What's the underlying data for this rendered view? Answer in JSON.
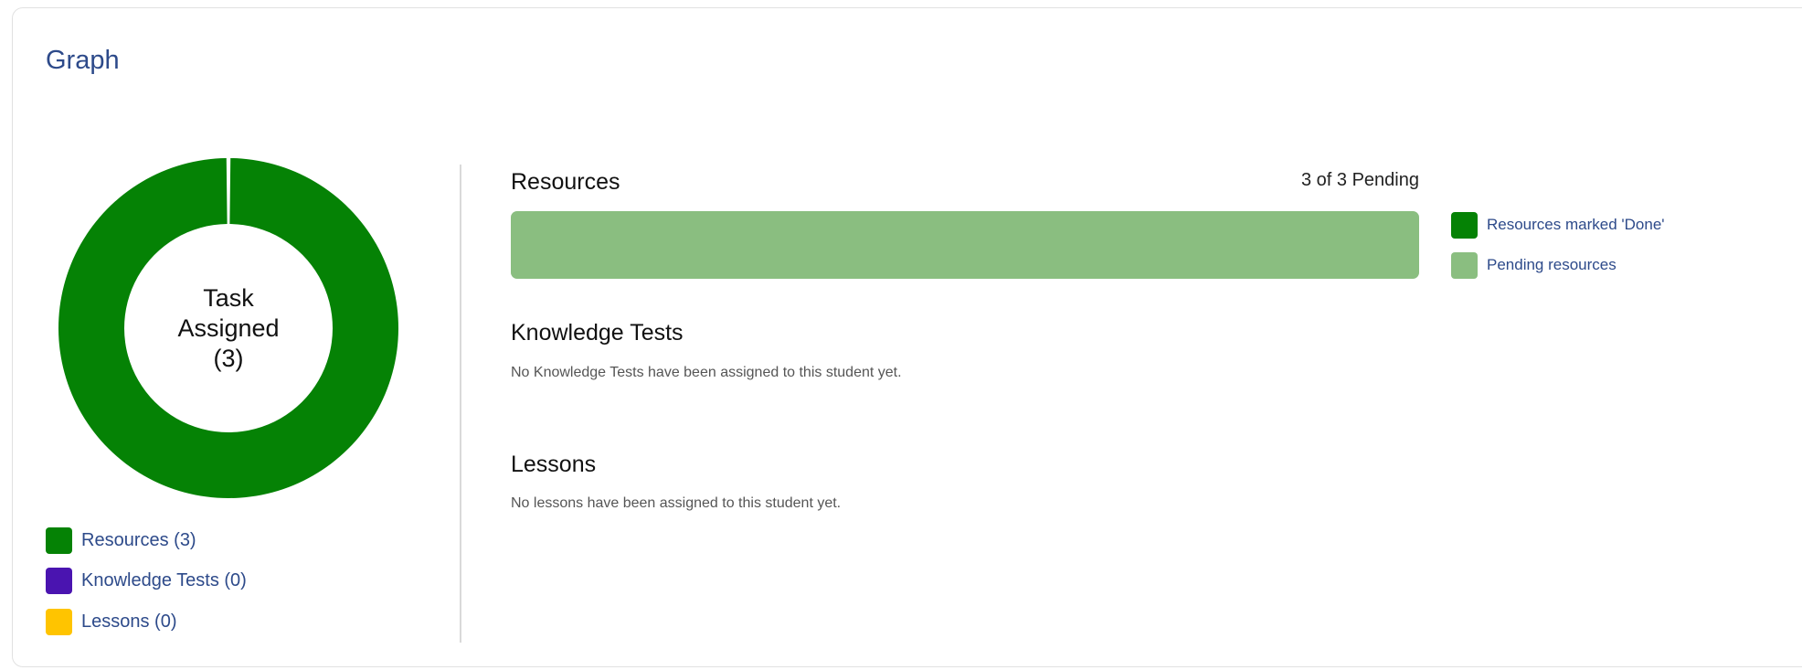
{
  "card": {
    "title": "Graph"
  },
  "donut": {
    "center_line1": "Task",
    "center_line2": "Assigned",
    "center_line3": "(3)"
  },
  "legend": [
    {
      "label": "Resources (3)",
      "color": "#058205",
      "value": 3
    },
    {
      "label": "Knowledge Tests (0)",
      "color": "#4a14b0",
      "value": 0
    },
    {
      "label": "Lessons (0)",
      "color": "#ffc400",
      "value": 0
    }
  ],
  "resources": {
    "title": "Resources",
    "pending_text": "3 of 3 Pending",
    "done": 0,
    "pending": 3,
    "total": 3,
    "legend": [
      {
        "label": "Resources marked 'Done'",
        "color": "#058205"
      },
      {
        "label": "Pending resources",
        "color": "#8abe80"
      }
    ]
  },
  "knowledge_tests": {
    "title": "Knowledge Tests",
    "empty_message": "No Knowledge Tests have been assigned to this student yet."
  },
  "lessons": {
    "title": "Lessons",
    "empty_message": "No lessons have been assigned to this student yet."
  },
  "chart_data": {
    "type": "pie",
    "categories": [
      "Resources",
      "Knowledge Tests",
      "Lessons"
    ],
    "values": [
      3,
      0,
      0
    ],
    "colors": [
      "#058205",
      "#4a14b0",
      "#ffc400"
    ]
  }
}
